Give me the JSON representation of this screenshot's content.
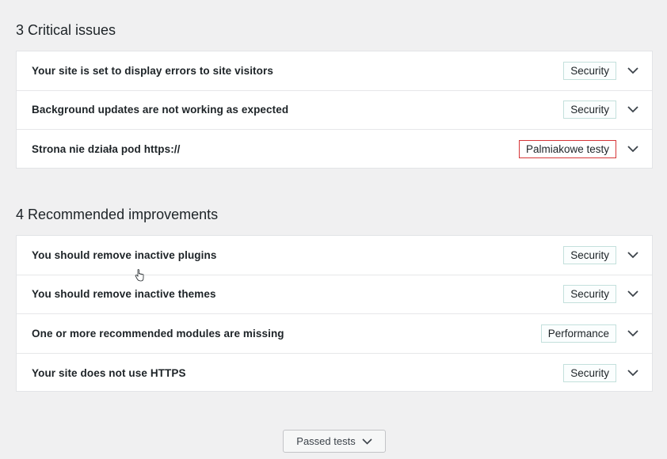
{
  "critical": {
    "heading": "3 Critical issues",
    "items": [
      {
        "title": "Your site is set to display errors to site visitors",
        "badge": "Security",
        "badge_color": "#c3e0dc"
      },
      {
        "title": "Background updates are not working as expected",
        "badge": "Security",
        "badge_color": "#c3e0dc"
      },
      {
        "title": "Strona nie działa pod https://",
        "badge": "Palmiakowe testy",
        "badge_color": "#d63638"
      }
    ]
  },
  "recommended": {
    "heading": "4 Recommended improvements",
    "items": [
      {
        "title": "You should remove inactive plugins",
        "badge": "Security"
      },
      {
        "title": "You should remove inactive themes",
        "badge": "Security"
      },
      {
        "title": "One or more recommended modules are missing",
        "badge": "Performance"
      },
      {
        "title": "Your site does not use HTTPS",
        "badge": "Security"
      }
    ]
  },
  "passed_tests": {
    "label": "Passed tests",
    "icon": "chevron-down-icon"
  },
  "colors": {
    "background": "#f0f0f1",
    "panel": "#ffffff",
    "badge_border": "#c3e0dc",
    "badge_alert_border": "#d63638"
  }
}
